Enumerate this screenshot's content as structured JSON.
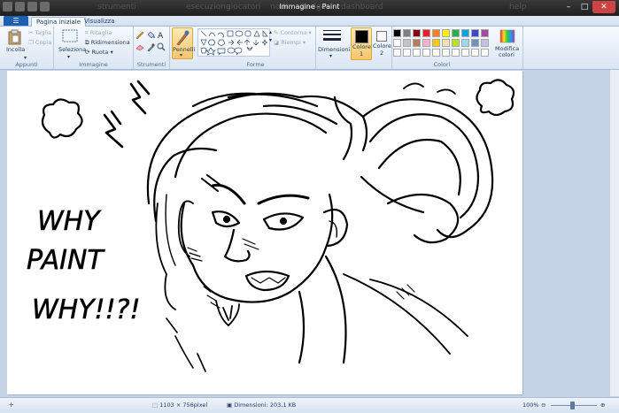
{
  "window": {
    "title": "Immagine - Paint",
    "ghost_tabs": [
      "strumenti",
      "esecuzione",
      "giocatori",
      "nodi",
      "badge",
      "dashboard",
      "help"
    ]
  },
  "tabs": {
    "file_icon": "paint-menu-icon",
    "home": "Pagina iniziale",
    "view": "Visualizza"
  },
  "ribbon": {
    "clipboard": {
      "paste": "Incolla",
      "cut": "Taglia",
      "copy": "Copia",
      "group": "Appunti"
    },
    "image": {
      "select": "Seleziona",
      "crop": "Ritaglia",
      "resize": "Ridimensiona",
      "rotate": "Ruota",
      "group": "Immagine"
    },
    "tools": {
      "group": "Strumenti"
    },
    "brushes": {
      "label": "Pennelli"
    },
    "shapes": {
      "outline": "Contorno",
      "fill": "Riempi",
      "group": "Forme"
    },
    "size": {
      "label": "Dimensioni"
    },
    "color1": {
      "label": "Colore",
      "num": "1",
      "value": "#000000"
    },
    "color2": {
      "label": "Colore",
      "num": "2",
      "value": "#ffffff"
    },
    "colors_group": "Colori",
    "edit_colors": {
      "line1": "Modifica",
      "line2": "colori"
    },
    "palette": [
      "#000000",
      "#7f7f7f",
      "#880015",
      "#ed1c24",
      "#ff7f27",
      "#fff200",
      "#22b14c",
      "#00a2e8",
      "#3f48cc",
      "#a349a4",
      "#ffffff",
      "#c3c3c3",
      "#b97a57",
      "#ffaec9",
      "#ffc90e",
      "#efe4b0",
      "#b5e61d",
      "#99d9ea",
      "#7092be",
      "#c8bfe7",
      "#ffffff",
      "#ffffff",
      "#ffffff",
      "#ffffff",
      "#ffffff",
      "#ffffff",
      "#ffffff",
      "#ffffff",
      "#ffffff",
      "#ffffff"
    ]
  },
  "canvas": {
    "text_lines": [
      "WHY",
      "PAINT",
      "WHY!!?!"
    ]
  },
  "status": {
    "image_size": "1103 × 756pixel",
    "file_size": "Dimensioni: 203,1 KB",
    "zoom": "100%"
  }
}
